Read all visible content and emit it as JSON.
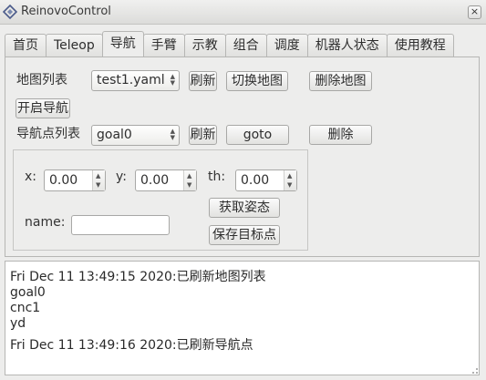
{
  "window": {
    "title": "ReinovoControl",
    "close_glyph": "×",
    "icons": {
      "app": "diamond-app-icon",
      "close": "close-icon"
    }
  },
  "tabs": [
    "首页",
    "Teleop",
    "导航",
    "手臂",
    "示教",
    "组合",
    "调度",
    "机器人状态",
    "使用教程"
  ],
  "active_tab": "导航",
  "map": {
    "label": "地图列表",
    "selected": "test1.yaml",
    "refresh": "刷新",
    "switch": "切换地图",
    "delete": "删除地图"
  },
  "start_nav": "开启导航",
  "waypoints": {
    "label": "导航点列表",
    "selected": "goal0",
    "refresh": "刷新",
    "goto": "goto",
    "delete": "删除"
  },
  "pose": {
    "x_label": "x:",
    "x_value": "0.00",
    "y_label": "y:",
    "y_value": "0.00",
    "th_label": "th:",
    "th_value": "0.00",
    "get_pose": "获取姿态",
    "name_label": "name:",
    "name_value": "",
    "save_target": "保存目标点"
  },
  "log": [
    "Fri Dec 11 13:49:15 2020:已刷新地图列表",
    "goal0",
    "cnc1",
    "yd",
    "Fri Dec 11 13:49:16 2020:已刷新导航点"
  ]
}
